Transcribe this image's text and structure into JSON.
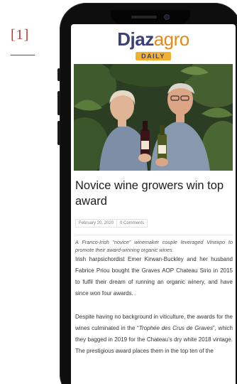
{
  "figure": {
    "reference_label": "[1]"
  },
  "logo": {
    "primary": "Djaz",
    "secondary": "agro",
    "badge": "DAILY"
  },
  "photo": {
    "subject": "couple holding wine bottles in vineyard greenery"
  },
  "article": {
    "headline": "Novice wine growers win top award",
    "date": "February 20, 2020",
    "comments": "0 Comments",
    "lede": "A Franco-Irish “novice” winemaker couple leveraged Vinexpo to promote their award-winning organic wines.",
    "paragraph_1": "Irish harpsichordist Emer Kirwan-Buckley and her husband Fabrice Priou bought the Graves AOP Chateau Sirio in 2015 to fulfil their dream of running an organic winery, and have since won four awards.",
    "paragraph_2_start": "Despite having no background in viticulture, the awards for the wines culminated in the “",
    "paragraph_2_award": "Trophée des Crus de Graves",
    "paragraph_2_mid": "”, which they bagged in 2019 for the Chateau’s dry white 2018 vintage. The prestigious award places them in the top ten of the"
  },
  "colors": {
    "brand_navy": "#3b3f7a",
    "brand_orange": "#e48a1c",
    "reference_red": "#c0392b"
  }
}
